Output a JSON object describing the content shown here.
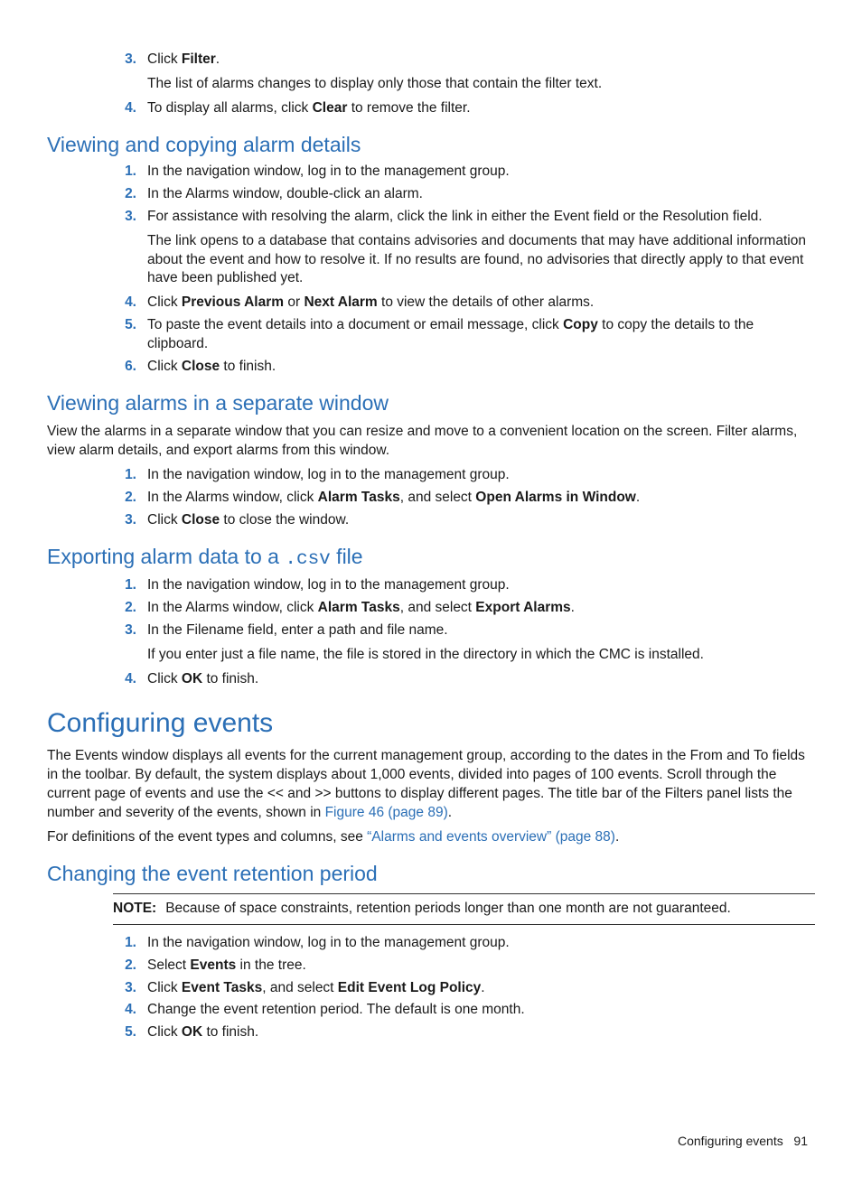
{
  "topSteps": [
    {
      "num": "3.",
      "parts": [
        {
          "t": "Click "
        },
        {
          "t": "Filter",
          "b": true
        },
        {
          "t": "."
        }
      ],
      "sub": "The list of alarms changes to display only those that contain the filter text."
    },
    {
      "num": "4.",
      "parts": [
        {
          "t": "To display all alarms, click "
        },
        {
          "t": "Clear",
          "b": true
        },
        {
          "t": " to remove the filter."
        }
      ]
    }
  ],
  "sec1": {
    "title": "Viewing and copying alarm details",
    "steps": [
      {
        "num": "1.",
        "parts": [
          {
            "t": "In the navigation window, log in to the management group."
          }
        ]
      },
      {
        "num": "2.",
        "parts": [
          {
            "t": "In the Alarms window, double-click an alarm."
          }
        ]
      },
      {
        "num": "3.",
        "parts": [
          {
            "t": "For assistance with resolving the alarm, click the link in either the Event field or the Resolution field."
          }
        ],
        "sub": "The link opens to a database that contains advisories and documents that may have additional information about the event and how to resolve it. If no results are found, no advisories that directly apply to that event have been published yet."
      },
      {
        "num": "4.",
        "parts": [
          {
            "t": "Click "
          },
          {
            "t": "Previous Alarm",
            "b": true
          },
          {
            "t": " or "
          },
          {
            "t": "Next Alarm",
            "b": true
          },
          {
            "t": " to view the details of other alarms."
          }
        ]
      },
      {
        "num": "5.",
        "parts": [
          {
            "t": "To paste the event details into a document or email message, click "
          },
          {
            "t": "Copy",
            "b": true
          },
          {
            "t": " to copy the details to the clipboard."
          }
        ]
      },
      {
        "num": "6.",
        "parts": [
          {
            "t": "Click "
          },
          {
            "t": "Close",
            "b": true
          },
          {
            "t": " to finish."
          }
        ]
      }
    ]
  },
  "sec2": {
    "title": "Viewing alarms in a separate window",
    "intro": "View the alarms in a separate window that you can resize and move to a convenient location on the screen. Filter alarms, view alarm details, and export alarms from this window.",
    "steps": [
      {
        "num": "1.",
        "parts": [
          {
            "t": "In the navigation window, log in to the management group."
          }
        ]
      },
      {
        "num": "2.",
        "parts": [
          {
            "t": "In the Alarms window, click "
          },
          {
            "t": "Alarm Tasks",
            "b": true
          },
          {
            "t": ", and select "
          },
          {
            "t": "Open Alarms in Window",
            "b": true
          },
          {
            "t": "."
          }
        ]
      },
      {
        "num": "3.",
        "parts": [
          {
            "t": "Click "
          },
          {
            "t": "Close",
            "b": true
          },
          {
            "t": " to close the window."
          }
        ]
      }
    ]
  },
  "sec3": {
    "title_pre": "Exporting alarm data to a ",
    "title_mono": ".csv",
    "title_post": " file",
    "steps": [
      {
        "num": "1.",
        "parts": [
          {
            "t": "In the navigation window, log in to the management group."
          }
        ]
      },
      {
        "num": "2.",
        "parts": [
          {
            "t": "In the Alarms window, click "
          },
          {
            "t": "Alarm Tasks",
            "b": true
          },
          {
            "t": ", and select "
          },
          {
            "t": "Export Alarms",
            "b": true
          },
          {
            "t": "."
          }
        ]
      },
      {
        "num": "3.",
        "parts": [
          {
            "t": "In the Filename field, enter a path and file name."
          }
        ],
        "sub": "If you enter just a file name, the file is stored in the directory in which the CMC is installed."
      },
      {
        "num": "4.",
        "parts": [
          {
            "t": "Click "
          },
          {
            "t": "OK",
            "b": true
          },
          {
            "t": " to finish."
          }
        ]
      }
    ]
  },
  "sec4": {
    "title": "Configuring events",
    "para1_pre": "The Events window displays all events for the current management group, according to the dates in the From and To fields in the toolbar. By default, the system displays about 1,000 events, divided into pages of 100 events. Scroll through the current page of events and use the << and >> buttons to display different pages. The title bar of the Filters panel lists the number and severity of the events, shown in ",
    "para1_link": "Figure 46 (page 89)",
    "para1_post": ".",
    "para2_pre": "For definitions of the event types and columns, see ",
    "para2_link": "“Alarms and events overview” (page 88)",
    "para2_post": "."
  },
  "sec5": {
    "title": "Changing the event retention period",
    "note_label": "NOTE:",
    "note_text": "Because of space constraints, retention periods longer than one month are not guaranteed.",
    "steps": [
      {
        "num": "1.",
        "parts": [
          {
            "t": "In the navigation window, log in to the management group."
          }
        ]
      },
      {
        "num": "2.",
        "parts": [
          {
            "t": "Select "
          },
          {
            "t": "Events",
            "b": true
          },
          {
            "t": " in the tree."
          }
        ]
      },
      {
        "num": "3.",
        "parts": [
          {
            "t": "Click "
          },
          {
            "t": "Event Tasks",
            "b": true
          },
          {
            "t": ", and select "
          },
          {
            "t": "Edit Event Log Policy",
            "b": true
          },
          {
            "t": "."
          }
        ]
      },
      {
        "num": "4.",
        "parts": [
          {
            "t": "Change the event retention period. The default is one month."
          }
        ]
      },
      {
        "num": "5.",
        "parts": [
          {
            "t": "Click "
          },
          {
            "t": "OK",
            "b": true
          },
          {
            "t": " to finish."
          }
        ]
      }
    ]
  },
  "footer": {
    "text": "Configuring events",
    "page": "91"
  }
}
